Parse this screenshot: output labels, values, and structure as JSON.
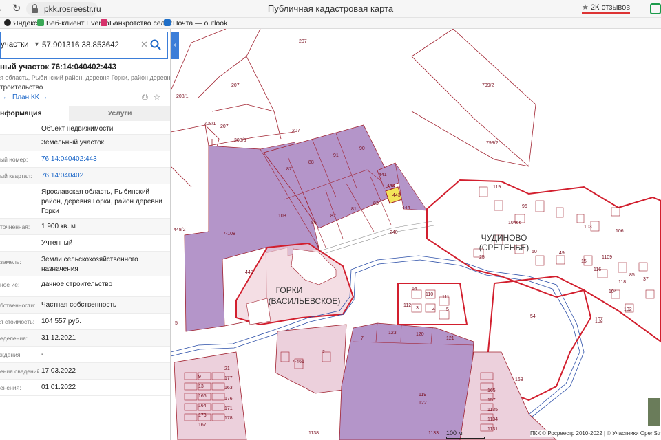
{
  "browser": {
    "url": "pkk.rosreestr.ru",
    "page_title": "Публичная кадастровая карта",
    "reviews": "2К отзывов",
    "bookmarks": [
      {
        "label": "Яндекс",
        "color": "#222222"
      },
      {
        "label": "Веб-клиент Everno",
        "color": "#3aa856"
      },
      {
        "label": "Банкротство сельх",
        "color": "#d6336c"
      },
      {
        "label": "Почта — outlook",
        "color": "#1f6fc8"
      }
    ]
  },
  "search": {
    "type_label": "участки",
    "query": "57.901316 38.853642"
  },
  "object": {
    "title": "ный участок 76:14:040402:443",
    "address_short": "я область, Рыбинский район, деревня Горки, район деревни Горки",
    "subtitle": "троительство",
    "link_back": "→",
    "link_plan": "План КК →"
  },
  "tabs": {
    "info": "нформация",
    "services": "Услуги"
  },
  "info_rows": [
    {
      "label": "",
      "value": "Объект недвижимости"
    },
    {
      "label": "",
      "value": "Земельный участок"
    },
    {
      "label": "ый номер:",
      "value": "76:14:040402:443",
      "link": true
    },
    {
      "label": "ый квартал:",
      "value": "76:14:040402",
      "link": true
    },
    {
      "label": "",
      "value": "Ярославская область, Рыбинский район, деревня Горки, район деревни Горки"
    },
    {
      "label": "точненная:",
      "value": "1 900 кв. м"
    },
    {
      "label": "",
      "value": "Учтенный"
    },
    {
      "label": "земель:",
      "value": "Земли сельскохозяйственного назначения"
    },
    {
      "label": "ное\nие:",
      "value": "дачное строительство"
    },
    {
      "label": "бственности:",
      "value": "Частная собственность"
    },
    {
      "label": "я стоимость:",
      "value": "104 557 руб."
    },
    {
      "label": "еделения:",
      "value": "31.12.2021"
    },
    {
      "label": "ждения:",
      "value": "-"
    },
    {
      "label": "ения сведений:",
      "value": "17.03.2022"
    },
    {
      "label": "енения:",
      "value": "01.01.2022"
    }
  ],
  "map": {
    "colors": {
      "parcel_fill": "#b495c9",
      "parcel_stroke": "#a0202e",
      "village_stroke": "#d21f2e",
      "village_fill": "#f0d0d8",
      "selected_fill": "#f3e45a",
      "river": "#2c4fa8"
    },
    "labels": {
      "village_gorki": "ГОРКИ",
      "village_gorki_sub": "(ВАСИЛЬЕВСКОЕ)",
      "village_chudinovo": "ЧУДИНОВО",
      "village_chudinovo_sub": "(СРЕТЕНЬЕ)",
      "parcel_ids": [
        "207",
        "207",
        "799/2",
        "208/1",
        "207",
        "208/1",
        "207",
        "799/2",
        "208/3",
        "87",
        "88",
        "91",
        "90",
        "441",
        "442",
        "443",
        "444",
        "83",
        "81",
        "82",
        "86",
        "108",
        "7-108",
        "448",
        "240",
        "449/2",
        "10466",
        "119",
        "96",
        "5",
        "103",
        "106",
        "25",
        "50",
        "49",
        "15",
        "1109",
        "116",
        "118",
        "85",
        "37",
        "104",
        "102",
        "107",
        "54",
        "108",
        "64",
        "110",
        "111",
        "112",
        "3",
        "4",
        "5",
        "7",
        "123",
        "120",
        "121",
        "119",
        "122",
        "7-466",
        "2",
        "9",
        "21",
        "13",
        "177",
        "166",
        "163",
        "164",
        "176",
        "173",
        "171",
        "167",
        "178",
        "168",
        "165",
        "157",
        "1135",
        "1134",
        "1133",
        "1138",
        "1131",
        "1130",
        "110",
        "1-122",
        "1131"
      ]
    },
    "scale_label": "100 м",
    "attribution": "ПКК © Росреестр 2010-2022 | © Участники OpenStreetMap"
  }
}
